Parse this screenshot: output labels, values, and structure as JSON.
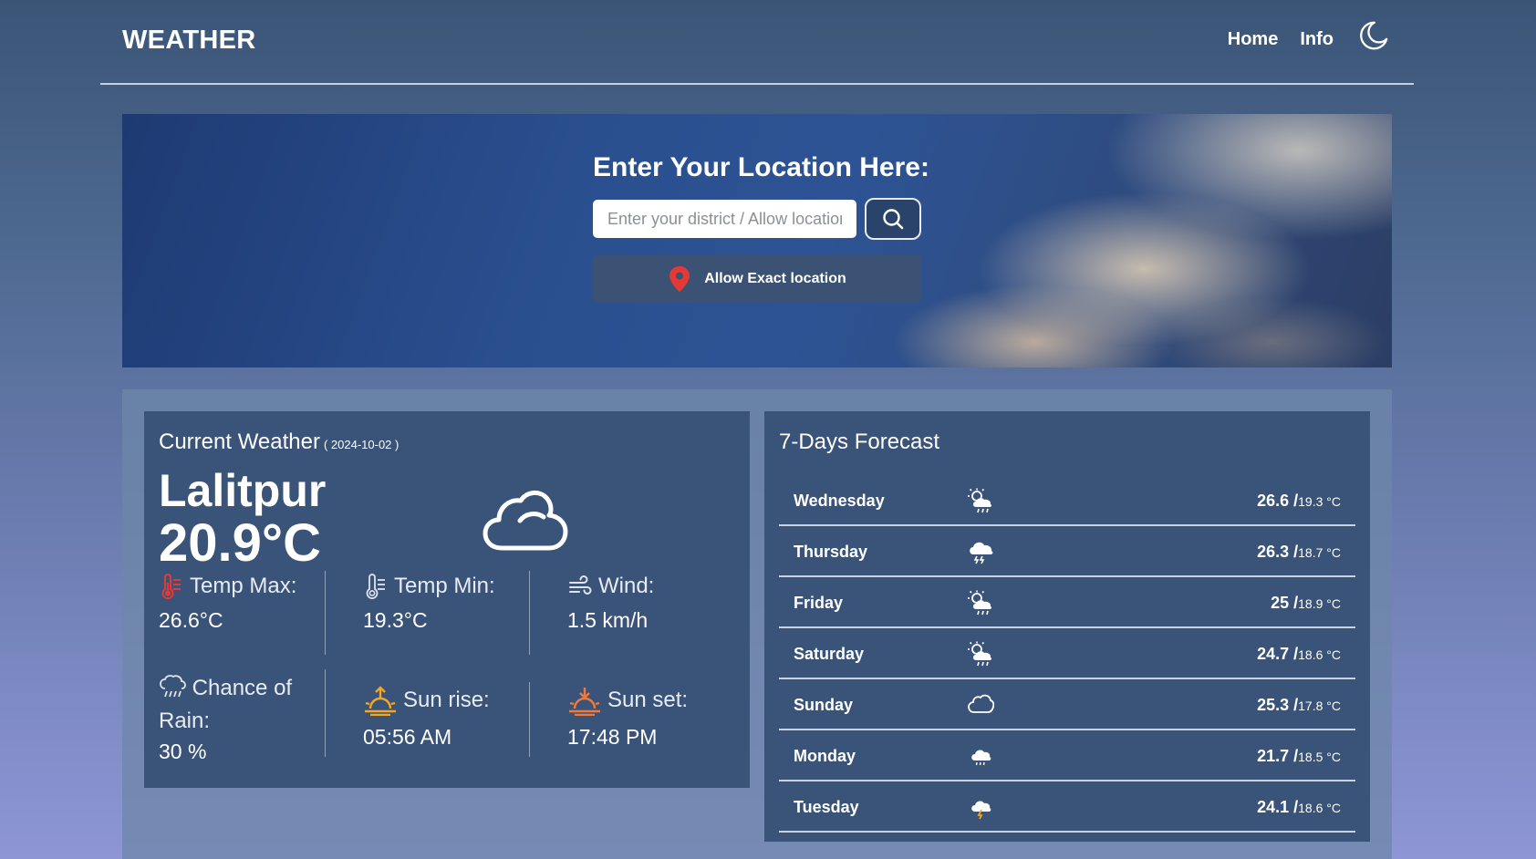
{
  "nav": {
    "brand": "WEATHER",
    "links": [
      "Home",
      "Info"
    ],
    "theme_icon": "moon-icon"
  },
  "hero": {
    "title": "Enter Your Location Here:",
    "search_placeholder": "Enter your district / Allow location",
    "search_icon": "search-icon",
    "location_button": "Allow Exact location",
    "location_icon": "map-pin-icon"
  },
  "current": {
    "title": "Current Weather",
    "date": "( 2024-10-02 )",
    "city": "Lalitpur",
    "temperature": "20.9°C",
    "condition_icon": "cloud-icon",
    "temp_max_label": "Temp Max:",
    "temp_max": "26.6°C",
    "temp_min_label": "Temp Min:",
    "temp_min": "19.3°C",
    "wind_label": "Wind:",
    "wind": "1.5 km/h",
    "rain_label_1": "Chance of",
    "rain_label_2": "Rain:",
    "rain": "30 %",
    "sunrise_label": "Sun rise:",
    "sunrise": "05:56 AM",
    "sunset_label": "Sun set:",
    "sunset": "17:48 PM"
  },
  "forecast": {
    "title": "7-Days Forecast",
    "days": [
      {
        "day": "Wednesday",
        "max": "26.6 /",
        "min": "19.3 °C",
        "icon": "sun-cloud-rain-icon"
      },
      {
        "day": "Thursday",
        "max": "26.3 /",
        "min": "18.7 °C",
        "icon": "cloud-thunder-icon"
      },
      {
        "day": "Friday",
        "max": "25 /",
        "min": "18.9 °C",
        "icon": "sun-cloud-rain-icon"
      },
      {
        "day": "Saturday",
        "max": "24.7 /",
        "min": "18.6 °C",
        "icon": "sun-cloud-rain-icon"
      },
      {
        "day": "Sunday",
        "max": "25.3 /",
        "min": "17.8 °C",
        "icon": "cloud-icon"
      },
      {
        "day": "Monday",
        "max": "21.7 /",
        "min": "18.5 °C",
        "icon": "cloud-drizzle-icon"
      },
      {
        "day": "Tuesday",
        "max": "24.1 /",
        "min": "18.6 °C",
        "icon": "storm-cloud-icon"
      }
    ]
  },
  "colors": {
    "accent_pin": "#e53935",
    "sun_icon": "#f5a623",
    "thermometer_max": "#e53935"
  }
}
